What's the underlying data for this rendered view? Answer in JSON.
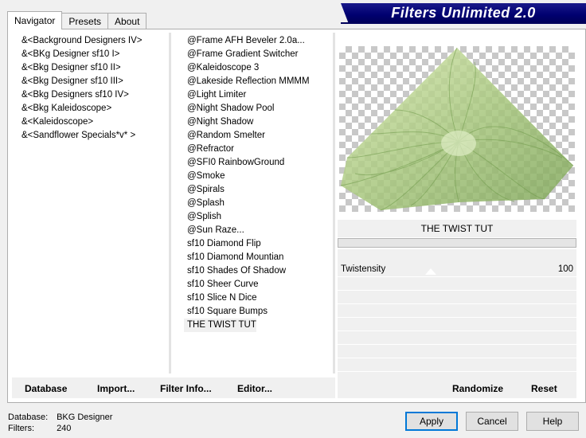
{
  "tabs": [
    "Navigator",
    "Presets",
    "About"
  ],
  "banner_title": "Filters Unlimited 2.0",
  "categories": [
    "&<Background Designers IV>",
    "&<BKg Designer sf10 I>",
    "&<Bkg Designer sf10 II>",
    "&<Bkg Designer sf10 III>",
    "&<Bkg Designers sf10 IV>",
    "&<Bkg Kaleidoscope>",
    "&<Kaleidoscope>",
    "&<Sandflower Specials*v* >"
  ],
  "filters": [
    "@Frame AFH Beveler 2.0a...",
    "@Frame Gradient Switcher",
    "@Kaleidoscope 3",
    "@Lakeside Reflection MMMM",
    "@Light Limiter",
    "@Night Shadow Pool",
    "@Night Shadow",
    "@Random Smelter",
    "@Refractor",
    "@SFI0 RainbowGround",
    "@Smoke",
    "@Spirals",
    "@Splash",
    "@Splish",
    "@Sun Raze...",
    "sf10 Diamond Flip",
    "sf10 Diamond Mountian",
    "sf10 Shades Of Shadow",
    "sf10 Sheer Curve",
    "sf10 Slice N Dice",
    "sf10 Square Bumps",
    "THE TWIST TUT"
  ],
  "selected_filter": "THE TWIST TUT",
  "filter_title": "THE TWIST TUT",
  "params": [
    {
      "label": "Twistensity",
      "value": "100"
    }
  ],
  "left_buttons": {
    "database": "Database",
    "import": "Import...",
    "filter_info": "Filter Info...",
    "editor": "Editor..."
  },
  "right_buttons": {
    "randomize": "Randomize",
    "reset": "Reset"
  },
  "footer": {
    "database_label": "Database:",
    "database_value": "BKG Designer",
    "filters_label": "Filters:",
    "filters_value": "240"
  },
  "dialog_buttons": {
    "apply": "Apply",
    "cancel": "Cancel",
    "help": "Help"
  },
  "colors": {
    "banner": "#000070",
    "accent": "#0078d7",
    "preview_green": "#9ec07a"
  }
}
